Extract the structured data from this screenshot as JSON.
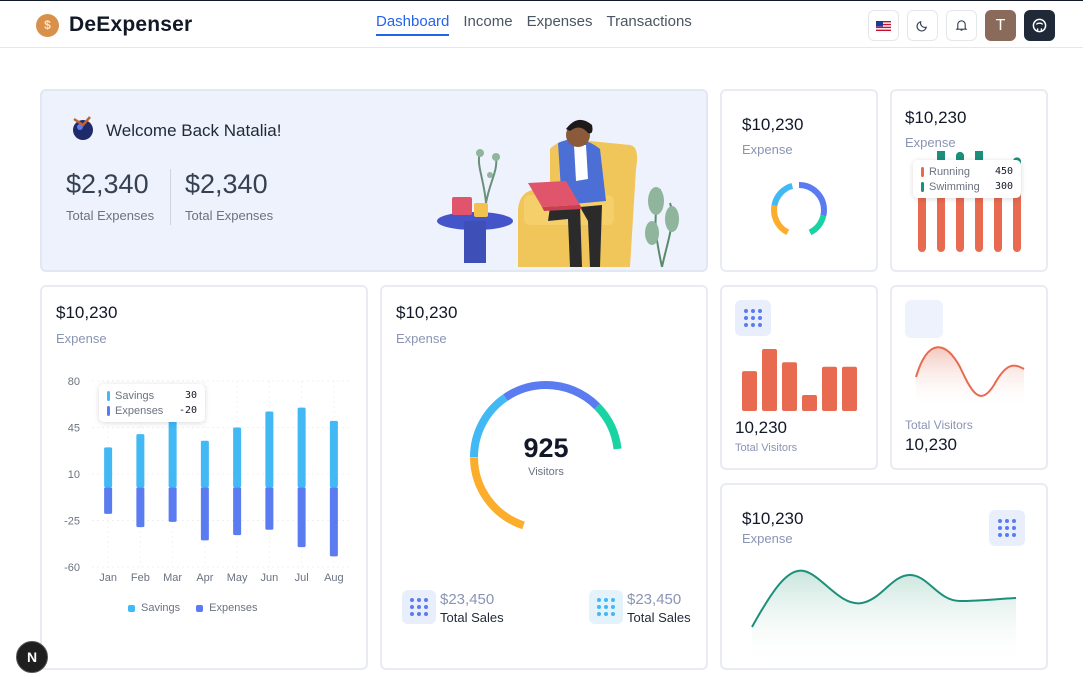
{
  "app": {
    "name": "DeExpenser",
    "logo_symbol": "$"
  },
  "nav": {
    "items": [
      "Dashboard",
      "Income",
      "Expenses",
      "Transactions"
    ],
    "active": "Dashboard"
  },
  "header_buttons": {
    "avatar_initial": "T",
    "icons": [
      "us-flag-icon",
      "moon-icon",
      "bell-icon",
      "github-icon"
    ]
  },
  "welcome": {
    "title": "Welcome Back Natalia!",
    "stats": [
      {
        "value": "$2,340",
        "label": "Total Expenses"
      },
      {
        "value": "$2,340",
        "label": "Total Expenses"
      }
    ]
  },
  "donut_small": {
    "amount": "$10,230",
    "label": "Expense",
    "colors": [
      "#5b7bf0",
      "#19d3a2",
      "#fbad2b",
      "#42b8f5"
    ]
  },
  "bar_tooltip_card": {
    "amount": "$10,230",
    "label": "Expense",
    "tooltip": [
      {
        "name": "Running",
        "value": "450",
        "color": "#e86a50"
      },
      {
        "name": "Swimming",
        "value": "300",
        "color": "#1c8f7b"
      }
    ]
  },
  "savings_chart": {
    "amount": "$10,230",
    "label": "Expense",
    "tooltip": [
      {
        "name": "Savings",
        "value": "30"
      },
      {
        "name": "Expenses",
        "value": "-20"
      }
    ],
    "legend": [
      "Savings",
      "Expenses"
    ]
  },
  "visitors_gauge": {
    "amount": "$10,230",
    "label": "Expense",
    "center_value": "925",
    "center_label": "Visitors",
    "sales": [
      {
        "value": "$23,450",
        "label": "Total Sales"
      },
      {
        "value": "$23,450",
        "label": "Total Sales"
      }
    ]
  },
  "visitors_bars": {
    "value": "10,230",
    "label": "Total Visitors",
    "bar_color": "#e86a50"
  },
  "visitors_wave": {
    "value": "10,230",
    "label": "Total Visitors"
  },
  "area_card": {
    "amount": "$10,230",
    "label": "Expense"
  },
  "chart_data": [
    {
      "type": "bar",
      "categories": [
        "Jan",
        "Feb",
        "Mar",
        "Apr",
        "May",
        "Jun",
        "Jul",
        "Aug"
      ],
      "series": [
        {
          "name": "Savings",
          "values": [
            30,
            40,
            50,
            35,
            45,
            57,
            60,
            50
          ],
          "color": "#42b8f5"
        },
        {
          "name": "Expenses",
          "values": [
            -20,
            -30,
            -26,
            -40,
            -36,
            -32,
            -45,
            -52
          ],
          "color": "#5b7bf0"
        }
      ],
      "yticks": [
        80,
        45,
        10,
        -25,
        -60
      ],
      "ylim": [
        -60,
        80
      ],
      "legend": "bottom"
    },
    {
      "type": "bar",
      "values": [
        45,
        70,
        55,
        18,
        50,
        50
      ],
      "color": "#e86a50"
    },
    {
      "type": "bar",
      "series": [
        {
          "name": "Running",
          "values": [
            45,
            60,
            55,
            60,
            50,
            55
          ],
          "color": "#e86a50"
        },
        {
          "name": "Swimming",
          "values": [
            30,
            40,
            45,
            50,
            40,
            35
          ],
          "color": "#1c8f7b"
        }
      ]
    }
  ]
}
